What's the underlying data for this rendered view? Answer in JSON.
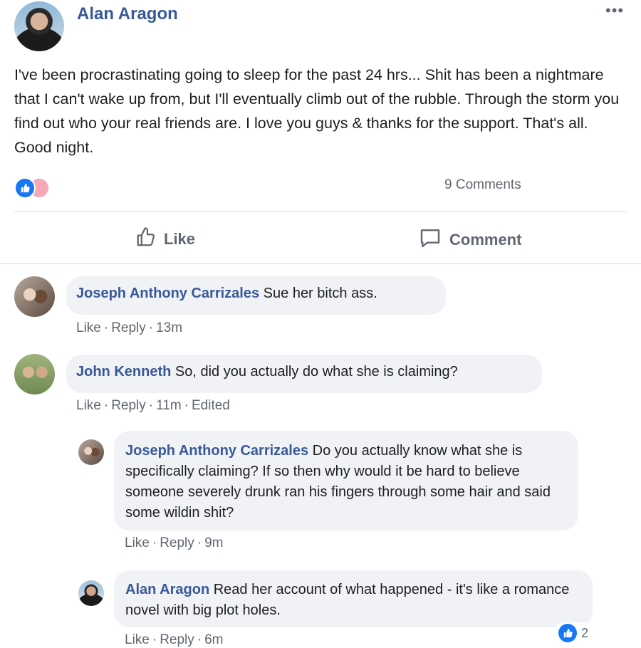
{
  "post": {
    "author": "Alan Aragon",
    "text": "I've been procrastinating going to sleep for the past 24 hrs... Shit has been a nightmare that I can't wake up from, but I'll eventually climb out of the rubble. Through the storm you find out who your real friends are. I love you guys & thanks for the support. That's all. Good night.",
    "comments_count": "9 Comments",
    "actions": {
      "like": "Like",
      "comment": "Comment"
    }
  },
  "comments": [
    {
      "author": "Joseph Anthony Carrizales",
      "text": "Sue her bitch ass.",
      "like": "Like",
      "reply": "Reply",
      "time": "13m",
      "edited": ""
    },
    {
      "author": "John Kenneth",
      "text": "So, did you actually do what she is claiming?",
      "like": "Like",
      "reply": "Reply",
      "time": "11m",
      "edited": "Edited"
    }
  ],
  "replies": [
    {
      "author": "Joseph Anthony Carrizales",
      "text": "Do you actually know what she is specifically claiming? If so then why would it be hard to believe someone severely drunk ran his fingers through some hair and said some wildin shit?",
      "like": "Like",
      "reply": "Reply",
      "time": "9m"
    },
    {
      "author": "Alan Aragon",
      "text": "Read her account of what happened - it's like a romance novel with big plot holes.",
      "like": "Like",
      "reply": "Reply",
      "time": "6m",
      "reaction_count": "2"
    }
  ],
  "colors": {
    "link": "#385898",
    "like_blue": "#1877f2",
    "bubble_bg": "#f0f2f5",
    "meta": "#606770"
  }
}
